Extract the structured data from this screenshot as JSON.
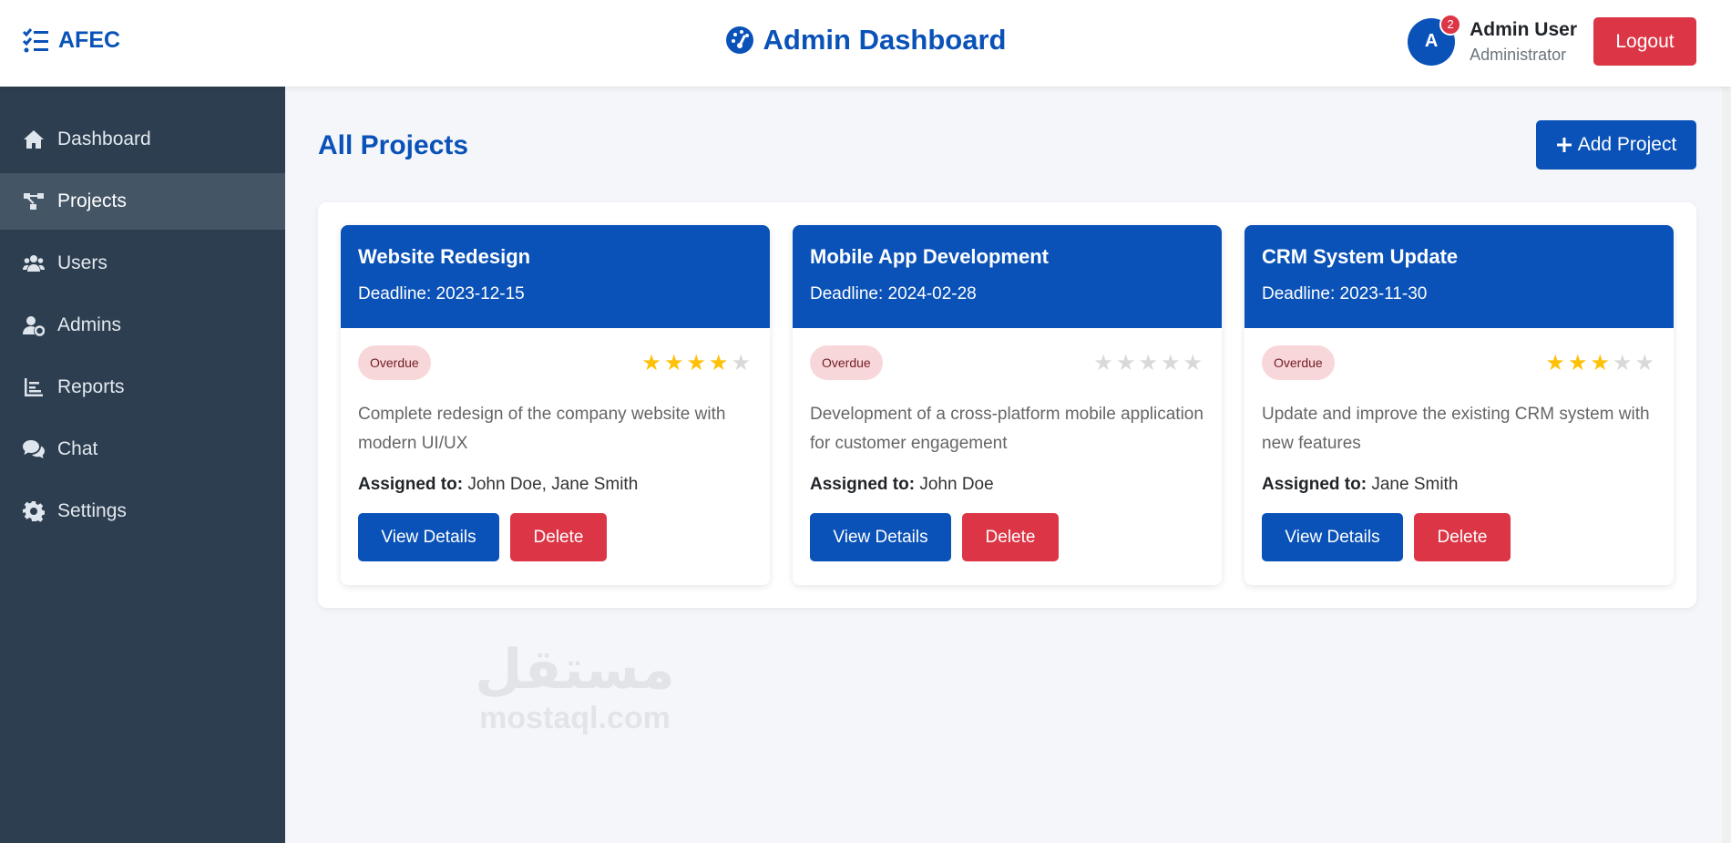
{
  "brand": {
    "name": "AFEC",
    "icon": "tasks-icon"
  },
  "header": {
    "title": "Admin Dashboard",
    "icon": "tachometer-icon"
  },
  "user": {
    "initial": "A",
    "notifications": "2",
    "name": "Admin User",
    "role": "Administrator",
    "logout_label": "Logout"
  },
  "sidebar": {
    "items": [
      {
        "label": "Dashboard",
        "icon": "home-icon",
        "active": false
      },
      {
        "label": "Projects",
        "icon": "project-diagram-icon",
        "active": true
      },
      {
        "label": "Users",
        "icon": "users-icon",
        "active": false
      },
      {
        "label": "Admins",
        "icon": "user-cog-icon",
        "active": false
      },
      {
        "label": "Reports",
        "icon": "chart-icon",
        "active": false
      },
      {
        "label": "Chat",
        "icon": "comments-icon",
        "active": false
      },
      {
        "label": "Settings",
        "icon": "gear-icon",
        "active": false
      }
    ]
  },
  "main": {
    "title": "All Projects",
    "add_label": "Add Project",
    "assigned_label": "Assigned to:",
    "view_label": "View Details",
    "delete_label": "Delete",
    "projects": [
      {
        "title": "Website Redesign",
        "deadline": "Deadline: 2023-12-15",
        "status": "Overdue",
        "rating": 4,
        "max_rating": 5,
        "description": "Complete redesign of the company website with modern UI/UX",
        "assigned": "John Doe, Jane Smith"
      },
      {
        "title": "Mobile App Development",
        "deadline": "Deadline: 2024-02-28",
        "status": "Overdue",
        "rating": 0,
        "max_rating": 5,
        "description": "Development of a cross-platform mobile application for customer engagement",
        "assigned": "John Doe"
      },
      {
        "title": "CRM System Update",
        "deadline": "Deadline: 2023-11-30",
        "status": "Overdue",
        "rating": 3,
        "max_rating": 5,
        "description": "Update and improve the existing CRM system with new features",
        "assigned": "Jane Smith"
      }
    ]
  },
  "watermark": {
    "arabic": "مستقل",
    "latin": "mostaql.com"
  },
  "colors": {
    "primary": "#0a52b8",
    "danger": "#dc3545",
    "sidebar": "#2c3e50",
    "star": "#ffc107"
  }
}
